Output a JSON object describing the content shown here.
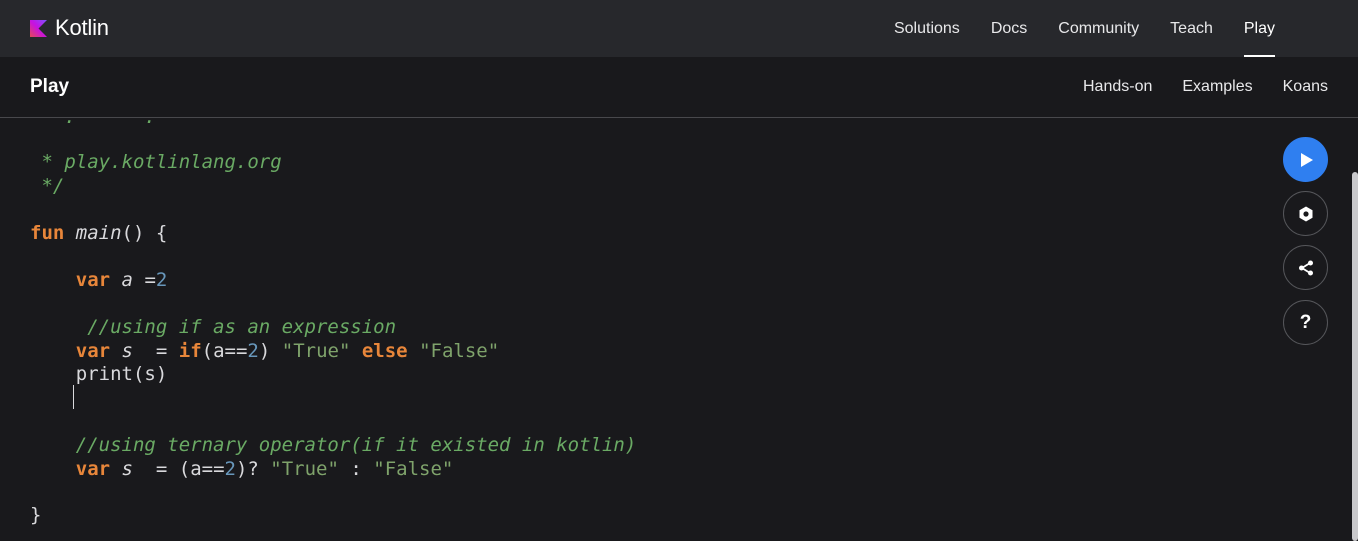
{
  "header": {
    "brand": "Kotlin",
    "nav": [
      {
        "label": "Solutions"
      },
      {
        "label": "Docs"
      },
      {
        "label": "Community"
      },
      {
        "label": "Teach"
      },
      {
        "label": "Play",
        "active": true
      }
    ]
  },
  "subheader": {
    "title": "Play",
    "nav": [
      {
        "label": "Hands-on"
      },
      {
        "label": "Examples"
      },
      {
        "label": "Koans"
      }
    ]
  },
  "editor": {
    "lines": {
      "l1": " * play.kotlinlang.org",
      "l2": " */",
      "l3_kw": "fun",
      "l3_fn": "main",
      "l3_rest": "() {",
      "l4_kw": "var",
      "l4_id": "a",
      "l4_op": " =",
      "l4_num": "2",
      "l5_cm": "//using if as an expression",
      "l6_kw": "var",
      "l6_id": "s",
      "l6_op": "  = ",
      "l6_if": "if",
      "l6_p1": "(a==",
      "l6_num": "2",
      "l6_p2": ") ",
      "l6_s1": "\"True\"",
      "l6_else": "else",
      "l6_s2": "\"False\"",
      "l7": "print(s)",
      "l8_cm": "//using ternary operator(if it existed in kotlin)",
      "l9_kw": "var",
      "l9_id": "s",
      "l9_op": "  = (a==",
      "l9_num": "2",
      "l9_p": ")? ",
      "l9_s1": "\"True\"",
      "l9_colon": " : ",
      "l9_s2": "\"False\"",
      "l10": "}"
    }
  },
  "side_buttons": {
    "help_label": "?"
  },
  "colors": {
    "brand_gradient": [
      "#7f52ff",
      "#e44857"
    ],
    "run_button": "#2f7ff0",
    "keyword": "#e8863a",
    "comment": "#6aaa64",
    "number": "#6897bb",
    "string": "#7fa36b"
  },
  "icons": [
    "kotlin-logo-icon",
    "run-icon",
    "settings-icon",
    "share-icon",
    "help-icon"
  ]
}
